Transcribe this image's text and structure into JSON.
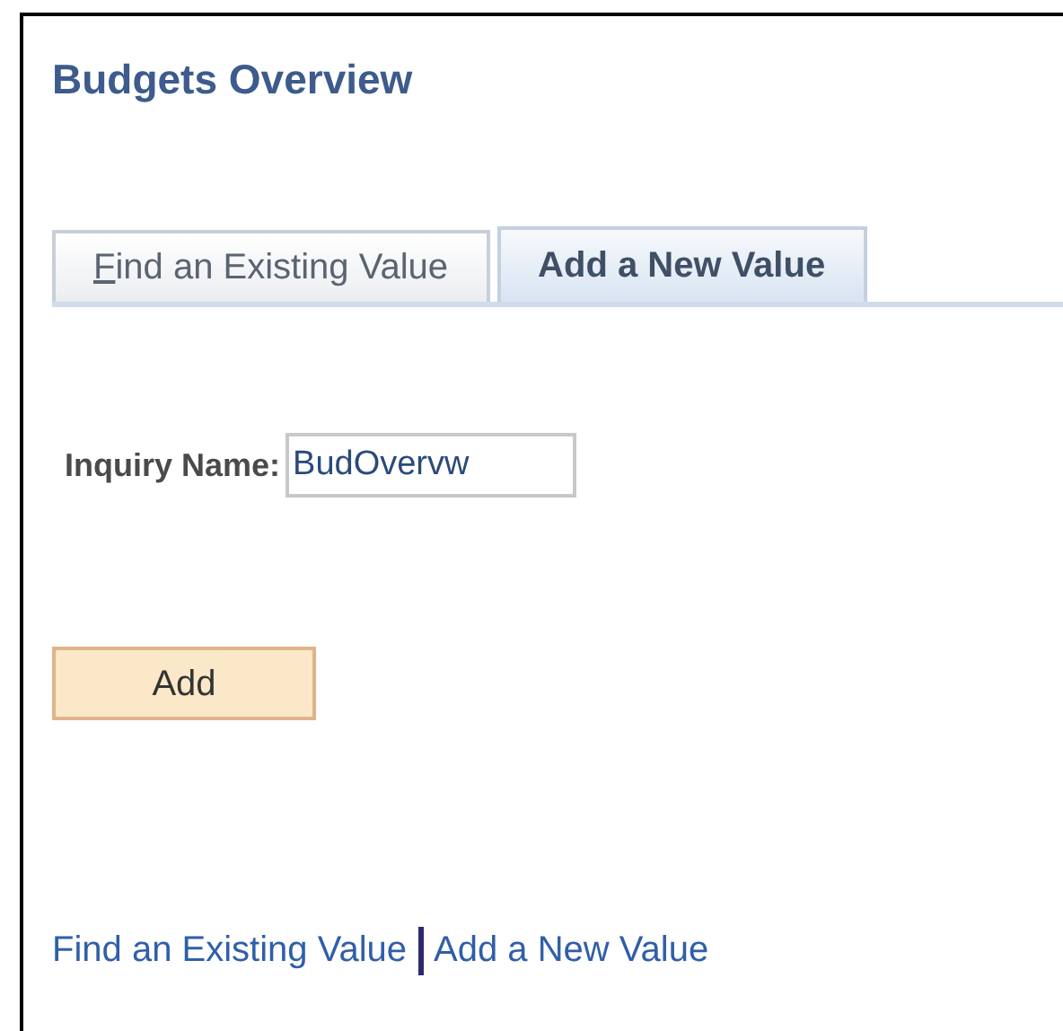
{
  "page": {
    "title": "Budgets Overview"
  },
  "tabs": [
    {
      "label": "Find an Existing Value",
      "selected": false,
      "underline_first": true
    },
    {
      "label": "Add a New Value",
      "selected": true,
      "underline_first": false
    }
  ],
  "form": {
    "label": "Inquiry Name:",
    "value": "BudOvervw"
  },
  "button": {
    "label": "Add"
  },
  "links": [
    "Find an Existing Value",
    "Add a New Value"
  ]
}
